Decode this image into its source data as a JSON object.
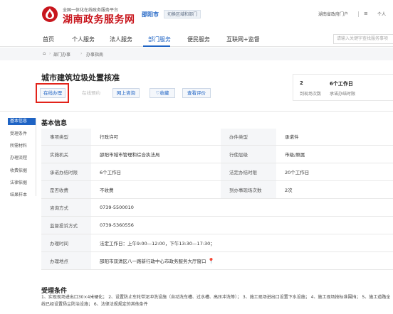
{
  "header": {
    "logo_sub": "全国一体化在线政务服务平台",
    "logo_main": "湖南政务服务网",
    "city": "邵阳市",
    "city_switch": "切换区域和部门",
    "portal_link": "湖南省政府门户",
    "menu_icon": "≡",
    "user_link": "个人"
  },
  "nav": {
    "items": [
      "首页",
      "个人服务",
      "法人服务",
      "部门服务",
      "便民服务",
      "互联网+监督"
    ],
    "active": "部门服务",
    "search_placeholder": "请输入关键字查找服务事项"
  },
  "breadcrumb": [
    "部门办事",
    "办事指南"
  ],
  "page": {
    "title": "城市建筑垃圾处置核准",
    "actions": [
      "在线办理",
      "在线预约",
      "网上咨询",
      "收藏",
      "查看评价"
    ],
    "stats": [
      {
        "value": "2",
        "label": "到现场次数"
      },
      {
        "value": "6个工作日",
        "label": "承诺办结时限"
      }
    ]
  },
  "sidebar": {
    "items": [
      "基本信息",
      "受理条件",
      "所需材料",
      "办理流程",
      "收费依据",
      "法律依据",
      "结果样本"
    ],
    "active": "基本信息"
  },
  "basic_info": {
    "title": "基本信息",
    "rows": [
      {
        "l1": "事项类型",
        "v1": "行政许可",
        "l2": "办件类型",
        "v2": "承诺件"
      },
      {
        "l1": "实施机关",
        "v1": "邵阳市城市管理和综合执法局",
        "l2": "行使层级",
        "v2": "市级/原属"
      },
      {
        "l1": "承诺办结时限",
        "v1": "6个工作日",
        "l2": "法定办结时限",
        "v2": "20个工作日"
      },
      {
        "l1": "是否收费",
        "v1": "不收费",
        "l2": "到办事现场次数",
        "v2": "2次"
      },
      {
        "l1": "咨询方式",
        "v1": "0739-5500010"
      },
      {
        "l1": "监督投诉方式",
        "v1": "0739-5360556"
      },
      {
        "l1": "办理时间",
        "v1": "法定工作日：上午9:00—12:00，下午13:30—17:30；"
      },
      {
        "l1": "办理地点",
        "v1": "邵阳市双清区八一路新行政中心市政务服务大厅窗口"
      }
    ],
    "location_icon": "📍"
  },
  "conditions": {
    "title": "受理条件",
    "text": "1、实现现场进出口30×4米硬化；  2、设置防止车轮带泥冲洗设施（自动洗车槽、过水槽、高压冲洗等）；  3、施工现场进出口设置下水设施；  4、施工现场按标准围挡；  5、施工道路全线已经设置扬尘防治设施；  6、法律法规规定的其他条件"
  },
  "colors": {
    "brand_red": "#c8161d",
    "accent_blue": "#1e63c4",
    "highlight_red": "#e2231a"
  }
}
